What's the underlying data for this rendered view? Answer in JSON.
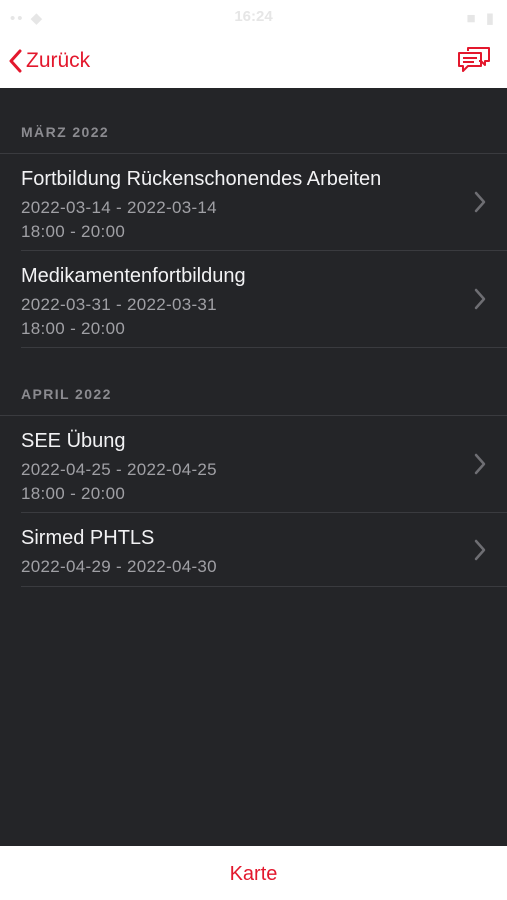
{
  "status_bar": {
    "left": "•• ◆",
    "time": "16:24",
    "right": "■ ▮"
  },
  "nav": {
    "back_label": "Zurück",
    "back_icon": "chevron-left-icon",
    "chat_icon": "chat-bubbles-icon",
    "accent": "#e3182d"
  },
  "sections": [
    {
      "header": "MÄRZ 2022",
      "items": [
        {
          "title": "Fortbildung Rückenschonendes Arbeiten",
          "dates": "2022-03-14 - 2022-03-14",
          "times": "18:00 - 20:00"
        },
        {
          "title": "Medikamentenfortbildung",
          "dates": "2022-03-31 - 2022-03-31",
          "times": "18:00 - 20:00"
        }
      ]
    },
    {
      "header": "APRIL 2022",
      "items": [
        {
          "title": "SEE Übung",
          "dates": "2022-04-25 - 2022-04-25",
          "times": "18:00 - 20:00"
        },
        {
          "title": "Sirmed PHTLS",
          "dates": "2022-04-29 - 2022-04-30"
        }
      ]
    }
  ],
  "bottom": {
    "label": "Karte"
  },
  "colors": {
    "background": "#242528",
    "separator": "#3a3b3f",
    "title_text": "#f2f2f4",
    "secondary_text": "#a0a0a5"
  }
}
